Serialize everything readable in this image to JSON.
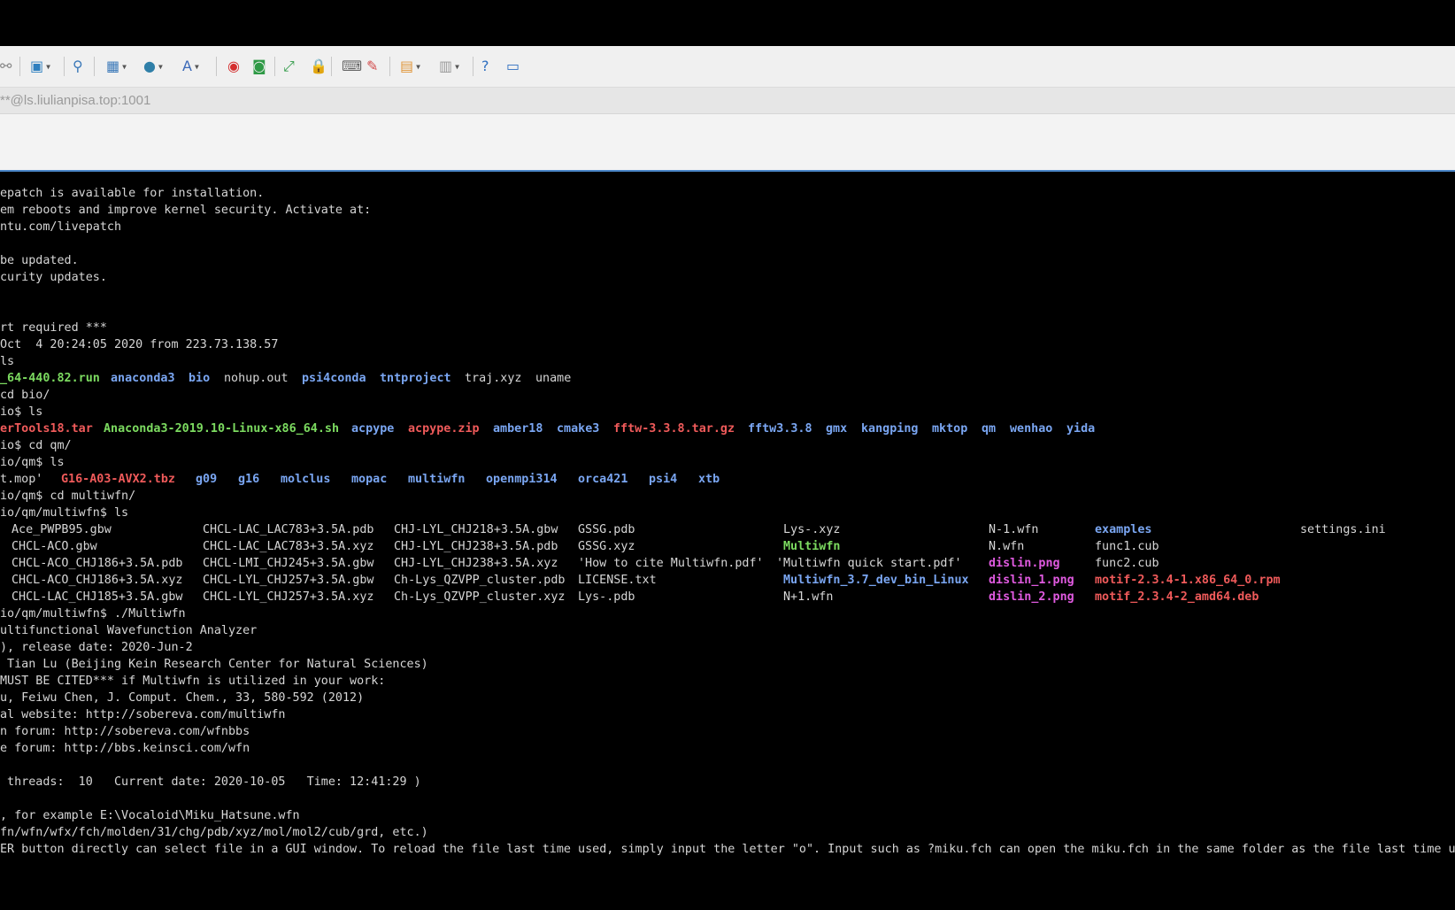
{
  "colors": {
    "terminal_bg": "#000000",
    "text": "#d6d6d6",
    "directory": "#7aa6f2",
    "executable": "#7cdb60",
    "archive": "#ef5a5a",
    "image": "#e05ae0",
    "toolbar_bg": "#f0f0f0",
    "accent": "#4a86c8"
  },
  "address": "**@ls.liulianpisa.top:1001",
  "toolbar": {
    "items": [
      {
        "icon": "connect-icon",
        "glyph": "⚯",
        "color": "#888888",
        "caret": false
      },
      {
        "icon": "new-session-icon",
        "glyph": "▣",
        "color": "#2e7fbf",
        "caret": true
      },
      {
        "icon": "search-icon",
        "glyph": "⚲",
        "color": "#3a78b8",
        "caret": false
      },
      {
        "icon": "transfer-icon",
        "glyph": "▦",
        "color": "#3a78b8",
        "caret": true
      },
      {
        "icon": "globe-icon",
        "glyph": "●",
        "color": "#2f7fa8",
        "caret": true
      },
      {
        "icon": "font-icon",
        "glyph": "A",
        "color": "#3c6ab8",
        "caret": true
      },
      {
        "icon": "xshell-icon",
        "glyph": "◉",
        "color": "#d42d2d",
        "caret": false
      },
      {
        "icon": "xftp-icon",
        "glyph": "◙",
        "color": "#2f9a46",
        "caret": false
      },
      {
        "icon": "fullscreen-icon",
        "glyph": "⤢",
        "color": "#2f9a46",
        "caret": false
      },
      {
        "icon": "lock-icon",
        "glyph": "🔒",
        "color": "#d0a23c",
        "caret": false
      },
      {
        "icon": "keyboard-icon",
        "glyph": "⌨",
        "color": "#666666",
        "caret": false
      },
      {
        "icon": "highlight-icon",
        "glyph": "✎",
        "color": "#d24a4a",
        "caret": false
      },
      {
        "icon": "folder-add-icon",
        "glyph": "▤",
        "color": "#e0963a",
        "caret": true
      },
      {
        "icon": "layout-icon",
        "glyph": "▥",
        "color": "#9a9a9a",
        "caret": true
      },
      {
        "icon": "help-icon",
        "glyph": "?",
        "color": "#2f6fc0",
        "caret": false
      },
      {
        "icon": "chat-icon",
        "glyph": "▭",
        "color": "#2f6fc0",
        "caret": false
      }
    ]
  },
  "terminal": {
    "lines": [
      "epatch is available for installation.",
      "em reboots and improve kernel security. Activate at:",
      "ntu.com/livepatch",
      "",
      "be updated.",
      "curity updates.",
      "",
      "",
      "rt required ***",
      "Oct  4 20:24:05 2020 from 223.73.138.57",
      "ls",
      "",
      "cd bio/",
      "io$ ls",
      "",
      "io$ cd qm/",
      "io/qm$ ls",
      "",
      "io/qm$ cd multiwfn/",
      "io/qm/multiwfn$ ls",
      "",
      "",
      "",
      "",
      "",
      "io/qm/multiwfn$ ./Multiwfn",
      "ultifunctional Wavefunction Analyzer",
      "), release date: 2020-Jun-2",
      " Tian Lu (Beijing Kein Research Center for Natural Sciences)",
      "MUST BE CITED*** if Multiwfn is utilized in your work:",
      "u, Feiwu Chen, J. Comput. Chem., 33, 580-592 (2012)",
      "al website: http://sobereva.com/multiwfn",
      "n forum: http://sobereva.com/wfnbbs",
      "e forum: http://bbs.keinsci.com/wfn",
      "",
      " threads:  10   Current date: 2020-10-05   Time: 12:41:29 )",
      "",
      ", for example E:\\Vocaloid\\Miku_Hatsune.wfn",
      "fn/wfn/wfx/fch/molden/31/chg/pdb/xyz/mol/mol2/cub/grd, etc.)",
      "ER button directly can select file in a GUI window. To reload the file last time used, simply input the letter \"o\". Input such as ?miku.fch can open the miku.fch in the same folder as the file last time used."
    ],
    "ls_home": [
      {
        "text": "_64-440.82.run",
        "type": "exe"
      },
      {
        "text": "anaconda3",
        "type": "dir"
      },
      {
        "text": "bio",
        "type": "dir"
      },
      {
        "text": "nohup.out",
        "type": "file"
      },
      {
        "text": "psi4conda",
        "type": "dir"
      },
      {
        "text": "tntproject",
        "type": "dir"
      },
      {
        "text": "traj.xyz",
        "type": "file"
      },
      {
        "text": "uname",
        "type": "file"
      }
    ],
    "ls_bio": [
      {
        "text": "erTools18.tar",
        "type": "arc"
      },
      {
        "text": "Anaconda3-2019.10-Linux-x86_64.sh",
        "type": "exe"
      },
      {
        "text": "acpype",
        "type": "dir"
      },
      {
        "text": "acpype.zip",
        "type": "arc"
      },
      {
        "text": "amber18",
        "type": "dir"
      },
      {
        "text": "cmake3",
        "type": "dir"
      },
      {
        "text": "fftw-3.3.8.tar.gz",
        "type": "arc"
      },
      {
        "text": "fftw3.3.8",
        "type": "dir"
      },
      {
        "text": "gmx",
        "type": "dir"
      },
      {
        "text": "kangping",
        "type": "dir"
      },
      {
        "text": "mktop",
        "type": "dir"
      },
      {
        "text": "qm",
        "type": "dir"
      },
      {
        "text": "wenhao",
        "type": "dir"
      },
      {
        "text": "yida",
        "type": "dir"
      }
    ],
    "ls_qm": [
      {
        "text": "t.mop'",
        "type": "file"
      },
      {
        "text": "G16-A03-AVX2.tbz",
        "type": "arc"
      },
      {
        "text": "g09",
        "type": "dir"
      },
      {
        "text": "g16",
        "type": "dir"
      },
      {
        "text": "molclus",
        "type": "dir"
      },
      {
        "text": "mopac",
        "type": "dir"
      },
      {
        "text": "multiwfn",
        "type": "dir"
      },
      {
        "text": "openmpi314",
        "type": "dir"
      },
      {
        "text": "orca421",
        "type": "dir"
      },
      {
        "text": "psi4",
        "type": "dir"
      },
      {
        "text": "xtb",
        "type": "dir"
      }
    ],
    "ls_multiwfn": [
      [
        {
          "text": "Ace_PWPB95.gbw",
          "type": "file"
        },
        {
          "text": "CHCL-LAC_LAC783+3.5A.pdb",
          "type": "file"
        },
        {
          "text": "CHJ-LYL_CHJ218+3.5A.gbw",
          "type": "file"
        },
        {
          "text": "GSSG.pdb",
          "type": "file"
        },
        {
          "text": "Lys-.xyz",
          "type": "file"
        },
        {
          "text": "N-1.wfn",
          "type": "file"
        },
        {
          "text": "examples",
          "type": "dir"
        },
        {
          "text": "settings.ini",
          "type": "file"
        }
      ],
      [
        {
          "text": "CHCL-ACO.gbw",
          "type": "file"
        },
        {
          "text": "CHCL-LAC_LAC783+3.5A.xyz",
          "type": "file"
        },
        {
          "text": "CHJ-LYL_CHJ238+3.5A.pdb",
          "type": "file"
        },
        {
          "text": "GSSG.xyz",
          "type": "file"
        },
        {
          "text": "Multiwfn",
          "type": "exe"
        },
        {
          "text": "N.wfn",
          "type": "file"
        },
        {
          "text": "func1.cub",
          "type": "file"
        },
        {
          "text": "",
          "type": "file"
        }
      ],
      [
        {
          "text": "CHCL-ACO_CHJ186+3.5A.pdb",
          "type": "file"
        },
        {
          "text": "CHCL-LMI_CHJ245+3.5A.gbw",
          "type": "file"
        },
        {
          "text": "CHJ-LYL_CHJ238+3.5A.xyz",
          "type": "file"
        },
        {
          "text": "'How to cite Multiwfn.pdf'",
          "type": "file"
        },
        {
          "text": "'Multiwfn quick start.pdf'",
          "type": "file"
        },
        {
          "text": "dislin.png",
          "type": "img"
        },
        {
          "text": "func2.cub",
          "type": "file"
        },
        {
          "text": "",
          "type": "file"
        }
      ],
      [
        {
          "text": "CHCL-ACO_CHJ186+3.5A.xyz",
          "type": "file"
        },
        {
          "text": "CHCL-LYL_CHJ257+3.5A.gbw",
          "type": "file"
        },
        {
          "text": "Ch-Lys_QZVPP_cluster.pdb",
          "type": "file"
        },
        {
          "text": "LICENSE.txt",
          "type": "file"
        },
        {
          "text": "Multiwfn_3.7_dev_bin_Linux",
          "type": "dir"
        },
        {
          "text": "dislin_1.png",
          "type": "img"
        },
        {
          "text": "motif-2.3.4-1.x86_64_0.rpm",
          "type": "arc"
        },
        {
          "text": "",
          "type": "file"
        }
      ],
      [
        {
          "text": "CHCL-LAC_CHJ185+3.5A.gbw",
          "type": "file"
        },
        {
          "text": "CHCL-LYL_CHJ257+3.5A.xyz",
          "type": "file"
        },
        {
          "text": "Ch-Lys_QZVPP_cluster.xyz",
          "type": "file"
        },
        {
          "text": "Lys-.pdb",
          "type": "file"
        },
        {
          "text": "N+1.wfn",
          "type": "file"
        },
        {
          "text": "dislin_2.png",
          "type": "img"
        },
        {
          "text": "motif_2.3.4-2_amd64.deb",
          "type": "arc"
        },
        {
          "text": "",
          "type": "file"
        }
      ]
    ]
  }
}
